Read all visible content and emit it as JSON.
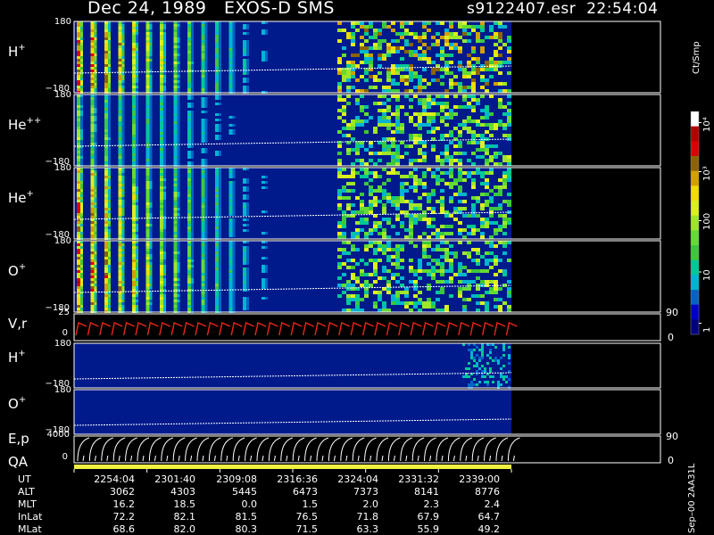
{
  "header": {
    "left": "Dec 24, 1989   EXOS-D SMS",
    "right": "s9122407.esr  22:54:04"
  },
  "chart_data": {
    "type": "heatmap",
    "spectrogram_panels": [
      {
        "label_main": "H",
        "label_sup": "+",
        "y_top": "180",
        "y_bottom": "−180"
      },
      {
        "label_main": "He",
        "label_sup": "++",
        "y_top": "180",
        "y_bottom": "−180"
      },
      {
        "label_main": "He",
        "label_sup": "+",
        "y_top": "180",
        "y_bottom": "−180"
      },
      {
        "label_main": "O",
        "label_sup": "+",
        "y_top": "180",
        "y_bottom": "−180"
      }
    ],
    "v_panel": {
      "label": "V,r",
      "y_top": "25",
      "y_bottom": "0",
      "right_top": "90",
      "right_bottom": "0"
    },
    "lower_panels": [
      {
        "label_main": "H",
        "label_sup": "+",
        "y_top": "180",
        "y_bottom": "−180"
      },
      {
        "label_main": "O",
        "label_sup": "+",
        "y_top": "180",
        "y_bottom": "−180"
      }
    ],
    "ep_panel": {
      "label": "E,p",
      "y_top": "4000",
      "y_bottom": "0",
      "right_top": "90",
      "right_bottom": "0"
    },
    "qa_label": "QA",
    "colorbar": {
      "title": "Ct/Smp",
      "ticks": [
        "10⁴",
        "10³",
        "100",
        "10",
        "1"
      ],
      "colors": [
        "#000080",
        "#0000c8",
        "#0064c8",
        "#00b4d2",
        "#00c896",
        "#3cc83c",
        "#64dc32",
        "#a0e628",
        "#dcf01e",
        "#f0dc00",
        "#d2a000",
        "#8c6400",
        "#dc0000",
        "#b40000",
        "#ffffff"
      ],
      "scale": "log"
    },
    "time_axis_ut": [
      "2254:04",
      "2301:40",
      "2309:08",
      "2316:36",
      "2324:04",
      "2331:32",
      "2339:00"
    ],
    "ephemeris": [
      {
        "name": "UT",
        "values": [
          "2254:04",
          "2301:40",
          "2309:08",
          "2316:36",
          "2324:04",
          "2331:32",
          "2339:00"
        ]
      },
      {
        "name": "ALT",
        "values": [
          "3062",
          "4303",
          "5445",
          "6473",
          "7373",
          "8141",
          "8776"
        ]
      },
      {
        "name": "MLT",
        "values": [
          "16.2",
          "18.5",
          "0.0",
          "1.5",
          "2.0",
          "2.3",
          "2.4"
        ]
      },
      {
        "name": "InLat",
        "values": [
          "72.2",
          "82.1",
          "81.5",
          "76.5",
          "71.8",
          "67.9",
          "64.7"
        ]
      },
      {
        "name": "MLat",
        "values": [
          "68.6",
          "82.0",
          "80.3",
          "71.5",
          "63.3",
          "55.9",
          "49.2"
        ]
      }
    ]
  },
  "footer_code": "Sep–00  2AA31L",
  "colors": {
    "background": "#000000",
    "spectrogram_bg": "#001a8c",
    "v_trace": "#e82818",
    "qa_bar": "#f0f040"
  }
}
